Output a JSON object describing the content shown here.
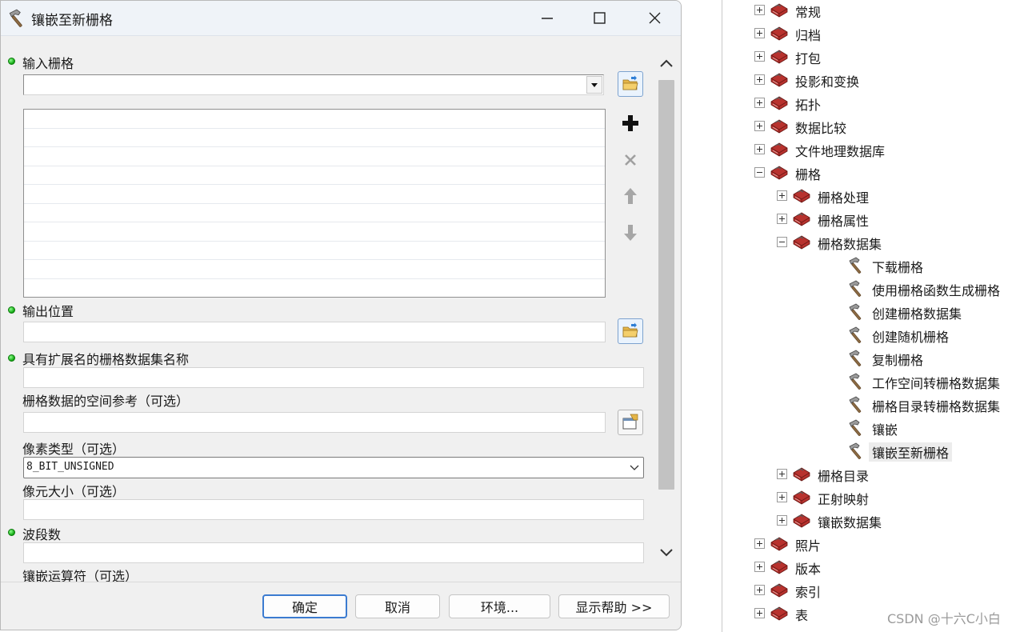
{
  "dialog": {
    "title": "镶嵌至新栅格",
    "params": {
      "input_rasters_label": "输入栅格",
      "input_rasters_value": "",
      "output_location_label": "输出位置",
      "output_location_value": "",
      "dataset_name_label": "具有扩展名的栅格数据集名称",
      "dataset_name_value": "",
      "spatial_ref_label": "栅格数据的空间参考（可选）",
      "spatial_ref_value": "",
      "pixel_type_label": "像素类型（可选）",
      "pixel_type_value": "8_BIT_UNSIGNED",
      "cellsize_label": "像元大小（可选）",
      "cellsize_value": "",
      "bands_label": "波段数",
      "bands_value": "",
      "mosaic_operator_label": "镶嵌运算符（可选）"
    },
    "buttons": {
      "ok": "确定",
      "cancel": "取消",
      "environments": "环境...",
      "show_help": "显示帮助 >>"
    }
  },
  "tree": {
    "items": [
      {
        "label": "常规",
        "state": "collapsed"
      },
      {
        "label": "归档",
        "state": "collapsed"
      },
      {
        "label": "打包",
        "state": "collapsed"
      },
      {
        "label": "投影和变换",
        "state": "collapsed"
      },
      {
        "label": "拓扑",
        "state": "collapsed"
      },
      {
        "label": "数据比较",
        "state": "collapsed"
      },
      {
        "label": "文件地理数据库",
        "state": "collapsed"
      },
      {
        "label": "栅格",
        "state": "expanded"
      },
      {
        "label": "栅格处理",
        "state": "collapsed"
      },
      {
        "label": "栅格属性",
        "state": "collapsed"
      },
      {
        "label": "栅格数据集",
        "state": "expanded"
      },
      {
        "label": "下载栅格",
        "state": "tool"
      },
      {
        "label": "使用栅格函数生成栅格",
        "state": "tool"
      },
      {
        "label": "创建栅格数据集",
        "state": "tool"
      },
      {
        "label": "创建随机栅格",
        "state": "tool"
      },
      {
        "label": "复制栅格",
        "state": "tool"
      },
      {
        "label": "工作空间转栅格数据集",
        "state": "tool"
      },
      {
        "label": "栅格目录转栅格数据集",
        "state": "tool"
      },
      {
        "label": "镶嵌",
        "state": "tool"
      },
      {
        "label": "镶嵌至新栅格",
        "state": "tool",
        "selected": true
      },
      {
        "label": "栅格目录",
        "state": "collapsed"
      },
      {
        "label": "正射映射",
        "state": "collapsed"
      },
      {
        "label": "镶嵌数据集",
        "state": "collapsed"
      },
      {
        "label": "照片",
        "state": "collapsed"
      },
      {
        "label": "版本",
        "state": "collapsed"
      },
      {
        "label": "索引",
        "state": "collapsed"
      },
      {
        "label": "表",
        "state": "collapsed"
      }
    ]
  },
  "watermark": "CSDN @十六C小白",
  "colors": {
    "required_marker": "#0ea30e",
    "primary_button_border": "#3b7bd0",
    "toolbox_red": "#b8322e"
  }
}
